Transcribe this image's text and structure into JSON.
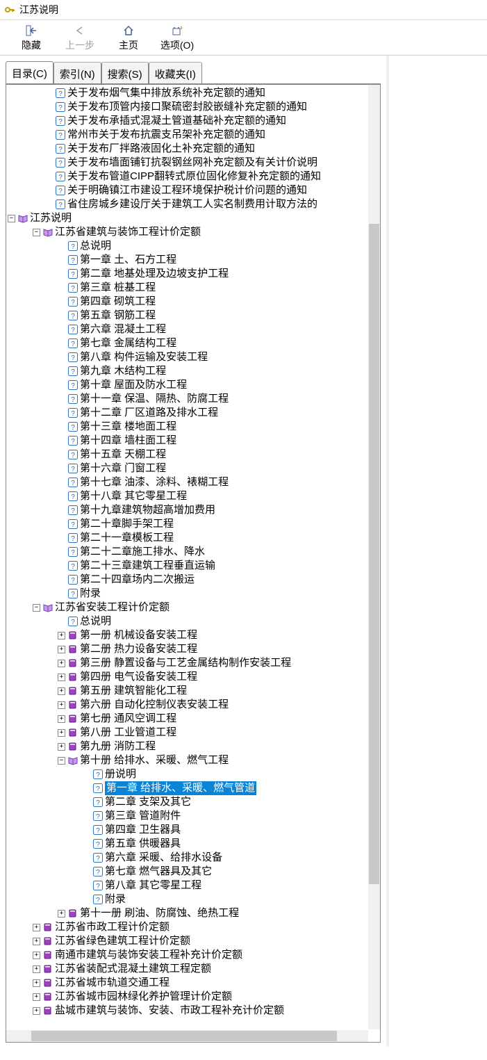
{
  "window": {
    "title": "江苏说明"
  },
  "toolbar": {
    "hide": "隐藏",
    "back": "上一步",
    "home": "主页",
    "options": "选项(O)"
  },
  "tabs": {
    "contents": "目录(C)",
    "index": "索引(N)",
    "search": "搜索(S)",
    "favorites": "收藏夹(I)"
  },
  "top_leaves": [
    "关于发布烟气集中排放系统补充定额的通知",
    "关于发布顶管内接口聚硫密封胶嵌缝补充定额的通知",
    "关于发布承插式混凝土管道基础补充定额的通知",
    "常州市关于发布抗震支吊架补充定额的通知",
    "关于发布厂拌路液固化土补充定额的通知",
    "关于发布墙面铺钉抗裂钢丝网补充定额及有关计价说明",
    "关于发布管道CIPP翻转式原位固化修复补充定额的通知",
    "关于明确镇江市建设工程环境保护税计价问题的通知",
    "省住房城乡建设厅关于建筑工人实名制费用计取方法的"
  ],
  "root2": "江苏说明",
  "folder_jz": "江苏省建筑与装饰工程计价定额",
  "jz_items": [
    "总说明",
    "第一章  土、石方工程",
    "第二章  地基处理及边坡支护工程",
    "第三章  桩基工程",
    "第四章  砌筑工程",
    "第五章  钢筋工程",
    "第六章  混凝土工程",
    "第七章  金属结构工程",
    "第八章  构件运输及安装工程",
    "第九章  木结构工程",
    "第十章  屋面及防水工程",
    "第十一章  保温、隔热、防腐工程",
    "第十二章  厂区道路及排水工程",
    "第十三章  楼地面工程",
    "第十四章  墙柱面工程",
    "第十五章  天棚工程",
    "第十六章  门窗工程",
    "第十七章  油漆、涂料、裱糊工程",
    "第十八章  其它零星工程",
    "第十九章建筑物超高增加费用",
    "第二十章脚手架工程",
    "第二十一章模板工程",
    "第二十二章施工排水、降水",
    "第二十三章建筑工程垂直运输",
    "第二十四章场内二次搬运",
    "附录"
  ],
  "folder_az": "江苏省安装工程计价定额",
  "az_general": "总说明",
  "az_books": [
    "第一册  机械设备安装工程",
    "第二册  热力设备安装工程",
    "第三册  静置设备与工艺金属结构制作安装工程",
    "第四册  电气设备安装工程",
    "第五册  建筑智能化工程",
    "第六册  自动化控制仪表安装工程",
    "第七册  通风空调工程",
    "第八册  工业管道工程",
    "第九册  消防工程"
  ],
  "az_book10": "第十册  给排水、采暖、燃气工程",
  "book10_items": [
    "册说明",
    "第一章  给排水、采暖、燃气管道",
    "第二章  支架及其它",
    "第三章  管道附件",
    "第四章  卫生器具",
    "第五章  供暖器具",
    "第六章  采暖、给排水设备",
    "第七章  燃气器具及其它",
    "第八章  其它零星工程",
    "附录"
  ],
  "book10_selected_index": 1,
  "az_book11": "第十一册  刷油、防腐蚀、绝热工程",
  "bottom_books": [
    "江苏省市政工程计价定额",
    "江苏省绿色建筑工程计价定额",
    "南通市建筑与装饰安装工程补充计价定额",
    "江苏省装配式混凝土建筑工程定额",
    "江苏省城市轨道交通工程",
    "江苏省城市园林绿化养护管理计价定额",
    "盐城市建筑与装饰、安装、市政工程补充计价定额"
  ]
}
